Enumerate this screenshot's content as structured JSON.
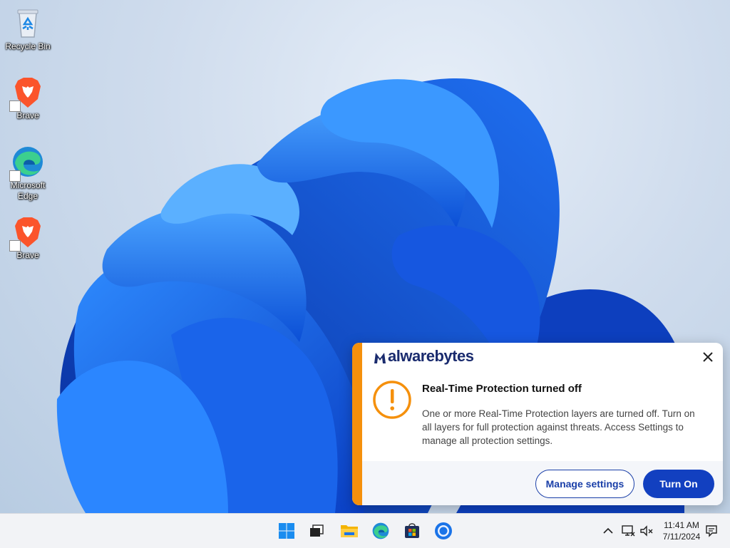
{
  "desktop": {
    "icons": [
      {
        "label": "Recycle Bin",
        "icon": "recycle-bin-icon"
      },
      {
        "label": "Brave",
        "icon": "brave-icon"
      },
      {
        "label": "Microsoft\nEdge",
        "icon": "edge-icon"
      },
      {
        "label": "Brave",
        "icon": "brave-icon"
      }
    ]
  },
  "toast": {
    "brand": "alwarebytes",
    "brand_icon": "malwarebytes-logo-icon",
    "title": "Real-Time Protection turned off",
    "message": "One or more Real-Time Protection layers are turned off. Turn on all layers for full protection against threats. Access Settings to manage all protection settings.",
    "manage_label": "Manage settings",
    "turn_on_label": "Turn On",
    "accent_color": "#f5900c",
    "primary_color": "#1240c0"
  },
  "taskbar": {
    "apps": [
      "start-icon",
      "task-view-icon",
      "file-explorer-icon",
      "edge-icon",
      "store-icon",
      "chrome-icon"
    ],
    "tray": [
      "chevron-up-icon",
      "network-icon",
      "volume-icon",
      "notification-icon"
    ],
    "time": "11:41 AM",
    "date": "7/11/2024"
  }
}
